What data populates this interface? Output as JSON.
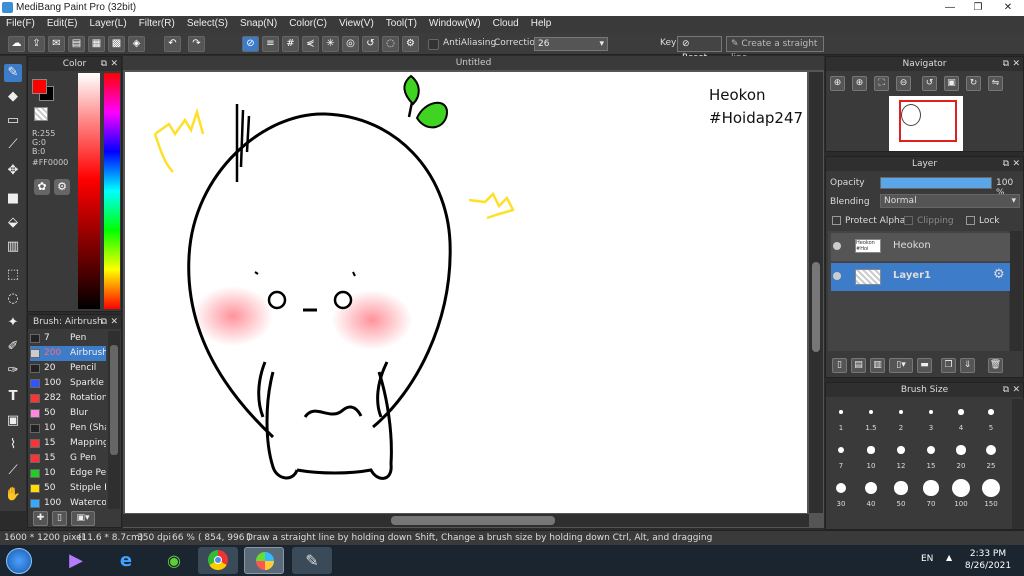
{
  "window": {
    "title": "MediBang Paint Pro (32bit)",
    "minimize": "—",
    "maximize": "❐",
    "close": "✕"
  },
  "menu": [
    "File(F)",
    "Edit(E)",
    "Layer(L)",
    "Filter(R)",
    "Select(S)",
    "Snap(N)",
    "Color(C)",
    "View(V)",
    "Tool(T)",
    "Window(W)",
    "Cloud",
    "Help"
  ],
  "toolbar": {
    "antialiasing_label": "AntiAliasing",
    "correction_label": "Correction",
    "correction_value": "26",
    "key_label": "Key",
    "reset_label": "Reset",
    "straight_line_label": "Create a straight line"
  },
  "color_panel": {
    "title": "Color",
    "r": "R:255",
    "g": "G:0",
    "b": "B:0",
    "hex": "#FF0000",
    "foreground": "#ff0000",
    "background": "#000000"
  },
  "brush_panel": {
    "title": "Brush: Airbrush",
    "items": [
      {
        "size": "7",
        "name": "Pen",
        "color": "#222222"
      },
      {
        "size": "200",
        "name": "Airbrush",
        "color": "#cccccc",
        "selected": true
      },
      {
        "size": "20",
        "name": "Pencil",
        "color": "#222222"
      },
      {
        "size": "100",
        "name": "Sparkle E",
        "color": "#3355ff"
      },
      {
        "size": "282",
        "name": "Rotation",
        "color": "#ff3333"
      },
      {
        "size": "50",
        "name": "Blur",
        "color": "#ff88dd"
      },
      {
        "size": "10",
        "name": "Pen (Sha",
        "color": "#222222"
      },
      {
        "size": "15",
        "name": "Mapping",
        "color": "#ff3333"
      },
      {
        "size": "15",
        "name": "G Pen",
        "color": "#ff3333"
      },
      {
        "size": "10",
        "name": "Edge Pen",
        "color": "#22cc22"
      },
      {
        "size": "50",
        "name": "Stipple P",
        "color": "#ffdd00"
      },
      {
        "size": "100",
        "name": "Waterco",
        "color": "#33aaff"
      }
    ]
  },
  "document": {
    "tab_title": "Untitled",
    "text_line1": "Heokon",
    "text_line2": "#Hoidap247"
  },
  "navigator": {
    "title": "Navigator"
  },
  "layer_panel": {
    "title": "Layer",
    "opacity_label": "Opacity",
    "opacity_value": "100 %",
    "opacity_fraction": 1.0,
    "blending_label": "Blending",
    "blending_value": "Normal",
    "protect_alpha": "Protect Alpha",
    "clipping": "Clipping",
    "lock": "Lock",
    "layers": [
      {
        "name": "Heokon",
        "selected": false
      },
      {
        "name": "Layer1",
        "selected": true
      }
    ]
  },
  "brush_size_panel": {
    "title": "Brush Size",
    "sizes": [
      "1",
      "1.5",
      "2",
      "3",
      "4",
      "5",
      "7",
      "10",
      "12",
      "15",
      "20",
      "25",
      "30",
      "40",
      "50",
      "70",
      "100",
      "150"
    ]
  },
  "status": {
    "dimensions": "1600 * 1200 pixel",
    "physical": "(11.6 * 8.7cm)",
    "dpi": "350 dpi",
    "zoom": "66 %",
    "coords": "( 854, 996 )",
    "hint": "Draw a straight line by holding down Shift, Change a brush size by holding down Ctrl, Alt, and dragging"
  },
  "taskbar": {
    "lang": "EN",
    "time": "2:33 PM",
    "date": "8/26/2021"
  }
}
